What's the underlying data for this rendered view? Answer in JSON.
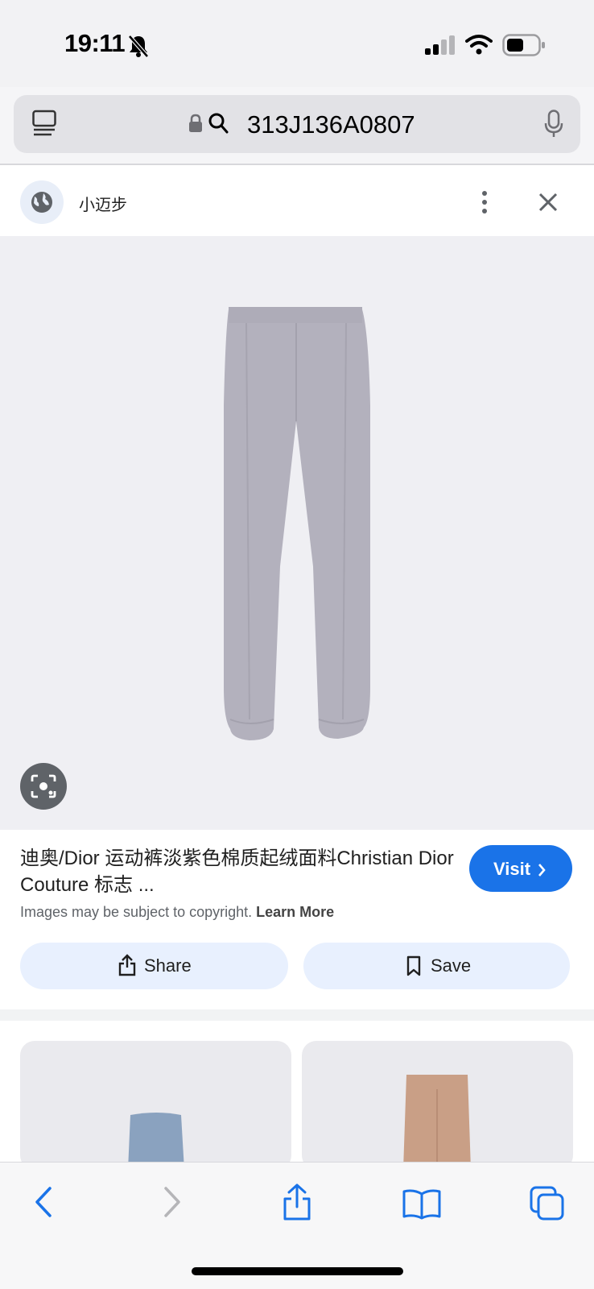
{
  "status_bar": {
    "time": "19:11",
    "icons": [
      "bell-slash-icon",
      "signal-icon",
      "wifi-icon",
      "battery-icon"
    ]
  },
  "browser": {
    "url_text": "313J136A0807",
    "icons": [
      "tabs-overview-icon",
      "lock-icon",
      "search-icon",
      "microphone-icon"
    ]
  },
  "source": {
    "site_name": "小迈步",
    "icons": [
      "globe-icon",
      "more-vertical-icon",
      "close-icon"
    ]
  },
  "result": {
    "title": "迪奥/Dior 运动裤淡紫色棉质起绒面料Christian Dior Couture 标志 ...",
    "visit_label": "Visit",
    "copyright_text": "Images may be subject to copyright.",
    "learn_more_label": "Learn More",
    "share_label": "Share",
    "save_label": "Save"
  },
  "toolbar": {
    "icons": [
      "back-icon",
      "forward-icon",
      "share-icon",
      "bookmarks-icon",
      "tabs-icon"
    ]
  },
  "colors": {
    "accent": "#1a73e8",
    "toolbar_blue": "#1a73e8",
    "pants_lavender": "#b3b1bd",
    "thumb_blue": "#8aa2bf",
    "thumb_tan": "#c99f86"
  }
}
